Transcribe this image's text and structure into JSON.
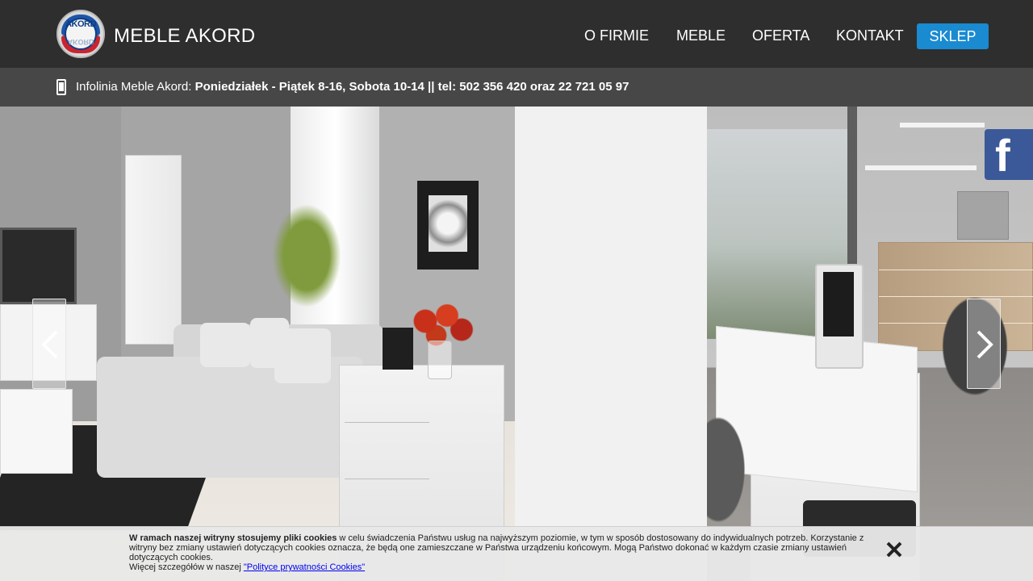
{
  "header": {
    "brand": "MEBLE AKORD",
    "logo_text": "AKORD",
    "nav": [
      {
        "label": "O FIRMIE"
      },
      {
        "label": "MEBLE"
      },
      {
        "label": "OFERTA"
      },
      {
        "label": "KONTAKT"
      }
    ],
    "shop_button": "SKLEP",
    "accent_color": "#1a8ad1"
  },
  "infobar": {
    "icon": "phone-icon",
    "prefix": "Infolinia Meble Akord: ",
    "hours": "Poniedziałek - Piątek 8-16, Sobota 10-14 || tel: 502 356 420 oraz 22 721 05 97"
  },
  "slider": {
    "prev_icon": "chevron-left-icon",
    "next_icon": "chevron-right-icon"
  },
  "facebook": {
    "letter": "f",
    "color": "#3b5998"
  },
  "cookie": {
    "bold": "W ramach naszej witryny stosujemy pliki cookies",
    "text": " w celu świadczenia Państwu usług na najwyższym poziomie, w tym w sposób dostosowany do indywidualnych potrzeb. Korzystanie z witryny bez zmiany ustawień dotyczących cookies oznacza, że będą one zamieszczane w Państwa urządzeniu końcowym. Mogą Państwo dokonać w każdym czasie zmiany ustawień dotyczących cookies.",
    "more_prefix": "Więcej szczegółów w naszej ",
    "link": "\"Polityce prywatności Cookies\"",
    "close_icon": "close-icon"
  }
}
